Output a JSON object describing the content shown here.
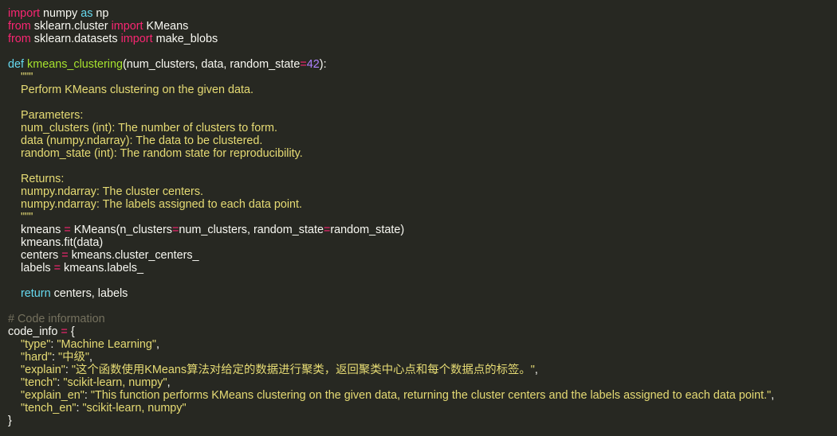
{
  "theme": {
    "background": "#272822",
    "foreground": "#f8f8f2",
    "keyword": "#f92672",
    "storage": "#66d9ef",
    "function": "#a6e22e",
    "number": "#ae81ff",
    "string": "#e6db74",
    "comment": "#75715e"
  },
  "code": {
    "lines": [
      [
        {
          "t": "import",
          "c": "kw"
        },
        {
          "t": " numpy ",
          "c": "plain"
        },
        {
          "t": "as",
          "c": "def"
        },
        {
          "t": " np",
          "c": "plain"
        }
      ],
      [
        {
          "t": "from",
          "c": "kw"
        },
        {
          "t": " sklearn.cluster ",
          "c": "plain"
        },
        {
          "t": "import",
          "c": "kw"
        },
        {
          "t": " KMeans",
          "c": "plain"
        }
      ],
      [
        {
          "t": "from",
          "c": "kw"
        },
        {
          "t": " sklearn.datasets ",
          "c": "plain"
        },
        {
          "t": "import",
          "c": "kw"
        },
        {
          "t": " make_blobs",
          "c": "plain"
        }
      ],
      [],
      [
        {
          "t": "def",
          "c": "def"
        },
        {
          "t": " ",
          "c": "plain"
        },
        {
          "t": "kmeans_clustering",
          "c": "fn"
        },
        {
          "t": "(num_clusters, data, random_state",
          "c": "plain"
        },
        {
          "t": "=",
          "c": "op"
        },
        {
          "t": "42",
          "c": "num"
        },
        {
          "t": "):",
          "c": "plain"
        }
      ],
      [
        {
          "t": "    \"\"\"",
          "c": "doc"
        }
      ],
      [
        {
          "t": "    Perform KMeans clustering on the given data.",
          "c": "doc"
        }
      ],
      [],
      [
        {
          "t": "    Parameters:",
          "c": "doc"
        }
      ],
      [
        {
          "t": "    num_clusters (int): The number of clusters to form.",
          "c": "doc"
        }
      ],
      [
        {
          "t": "    data (numpy.ndarray): The data to be clustered.",
          "c": "doc"
        }
      ],
      [
        {
          "t": "    random_state (int): The random state for reproducibility.",
          "c": "doc"
        }
      ],
      [],
      [
        {
          "t": "    Returns:",
          "c": "doc"
        }
      ],
      [
        {
          "t": "    numpy.ndarray: The cluster centers.",
          "c": "doc"
        }
      ],
      [
        {
          "t": "    numpy.ndarray: The labels assigned to each data point.",
          "c": "doc"
        }
      ],
      [
        {
          "t": "    \"\"\"",
          "c": "doc"
        }
      ],
      [
        {
          "t": "    kmeans ",
          "c": "plain"
        },
        {
          "t": "=",
          "c": "op"
        },
        {
          "t": " KMeans(n_clusters",
          "c": "plain"
        },
        {
          "t": "=",
          "c": "op"
        },
        {
          "t": "num_clusters, random_state",
          "c": "plain"
        },
        {
          "t": "=",
          "c": "op"
        },
        {
          "t": "random_state)",
          "c": "plain"
        }
      ],
      [
        {
          "t": "    kmeans.fit(data)",
          "c": "plain"
        }
      ],
      [
        {
          "t": "    centers ",
          "c": "plain"
        },
        {
          "t": "=",
          "c": "op"
        },
        {
          "t": " kmeans.cluster_centers_",
          "c": "plain"
        }
      ],
      [
        {
          "t": "    labels ",
          "c": "plain"
        },
        {
          "t": "=",
          "c": "op"
        },
        {
          "t": " kmeans.labels_",
          "c": "plain"
        }
      ],
      [],
      [
        {
          "t": "    ",
          "c": "plain"
        },
        {
          "t": "return",
          "c": "def"
        },
        {
          "t": " centers, labels",
          "c": "plain"
        }
      ],
      [],
      [
        {
          "t": "# Code information",
          "c": "cmt"
        }
      ],
      [
        {
          "t": "code_info ",
          "c": "plain"
        },
        {
          "t": "=",
          "c": "op"
        },
        {
          "t": " {",
          "c": "plain"
        }
      ],
      [
        {
          "t": "    ",
          "c": "plain"
        },
        {
          "t": "\"type\"",
          "c": "str"
        },
        {
          "t": ": ",
          "c": "plain"
        },
        {
          "t": "\"Machine Learning\"",
          "c": "str"
        },
        {
          "t": ",",
          "c": "plain"
        }
      ],
      [
        {
          "t": "    ",
          "c": "plain"
        },
        {
          "t": "\"hard\"",
          "c": "str"
        },
        {
          "t": ": ",
          "c": "plain"
        },
        {
          "t": "\"中级\"",
          "c": "str"
        },
        {
          "t": ",",
          "c": "plain"
        }
      ],
      [
        {
          "t": "    ",
          "c": "plain"
        },
        {
          "t": "\"explain\"",
          "c": "str"
        },
        {
          "t": ": ",
          "c": "plain"
        },
        {
          "t": "\"这个函数使用KMeans算法对给定的数据进行聚类，返回聚类中心点和每个数据点的标签。\"",
          "c": "str"
        },
        {
          "t": ",",
          "c": "plain"
        }
      ],
      [
        {
          "t": "    ",
          "c": "plain"
        },
        {
          "t": "\"tench\"",
          "c": "str"
        },
        {
          "t": ": ",
          "c": "plain"
        },
        {
          "t": "\"scikit-learn, numpy\"",
          "c": "str"
        },
        {
          "t": ",",
          "c": "plain"
        }
      ],
      [
        {
          "t": "    ",
          "c": "plain"
        },
        {
          "t": "\"explain_en\"",
          "c": "str"
        },
        {
          "t": ": ",
          "c": "plain"
        },
        {
          "t": "\"This function performs KMeans clustering on the given data, returning the cluster centers and the labels assigned to each data point.\"",
          "c": "str"
        },
        {
          "t": ",",
          "c": "plain"
        }
      ],
      [
        {
          "t": "    ",
          "c": "plain"
        },
        {
          "t": "\"tench_en\"",
          "c": "str"
        },
        {
          "t": ": ",
          "c": "plain"
        },
        {
          "t": "\"scikit-learn, numpy\"",
          "c": "str"
        }
      ],
      [
        {
          "t": "}",
          "c": "plain"
        }
      ]
    ]
  }
}
